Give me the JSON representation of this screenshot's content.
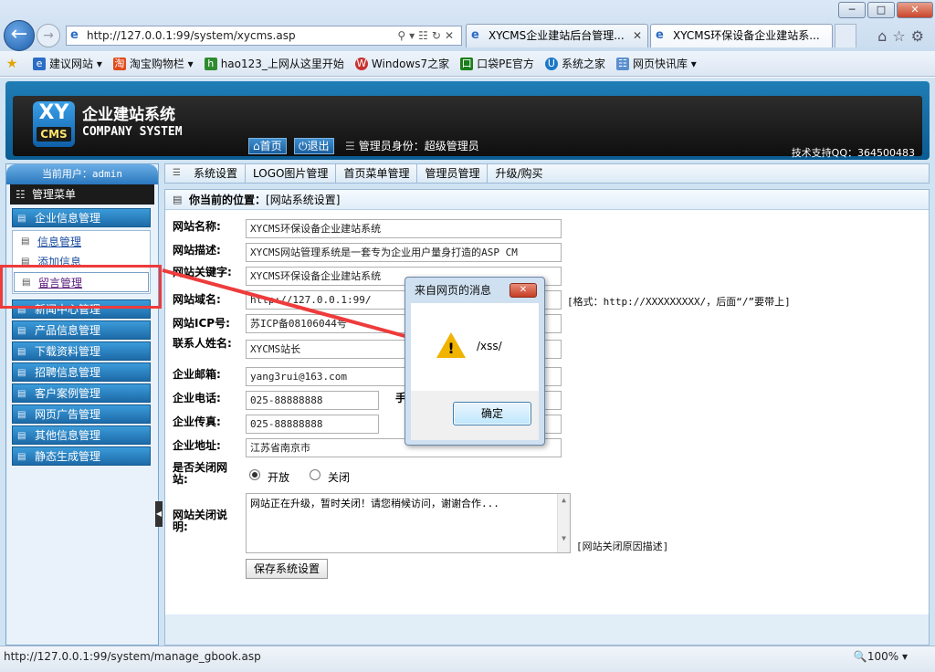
{
  "browser": {
    "address": "http://127.0.0.1:99/system/xycms.asp",
    "tabs": [
      {
        "label": "XYCMS企业建站后台管理..."
      },
      {
        "label": "XYCMS环保设备企业建站系..."
      }
    ],
    "window_buttons": {
      "minimize": "─",
      "maximize": "□",
      "close": "✕"
    },
    "favorites": [
      {
        "label": "建议网站 ▾",
        "icon": "ie-icon"
      },
      {
        "label": "淘宝购物栏 ▾",
        "icon": "taobao-icon"
      },
      {
        "label": "hao123_上网从这里开始",
        "icon": "hao123-icon"
      },
      {
        "label": "Windows7之家",
        "icon": "windows7-icon"
      },
      {
        "label": "口袋PE官方",
        "icon": "pe-icon"
      },
      {
        "label": "系统之家",
        "icon": "xitong-icon"
      },
      {
        "label": "网页快讯库 ▾",
        "icon": "webslice-icon"
      }
    ],
    "status_url": "http://127.0.0.1:99/system/manage_gbook.asp",
    "zoom": "🔍100% ▾"
  },
  "header": {
    "logo_top": "XY",
    "logo_bottom": "CMS",
    "brand_cn": "企业建站系统",
    "brand_en": "COMPANY SYSTEM",
    "home_label": "首页",
    "exit_label": "退出",
    "role_text": "管理员身份：超级管理员",
    "support_text": "技术支持QQ：364500483"
  },
  "sidebar": {
    "current_user": "当前用户：admin",
    "menu_title": "管理菜单",
    "categories": [
      "企业信息管理",
      "新闻中心管理",
      "产品信息管理",
      "下载资料管理",
      "招聘信息管理",
      "客户案例管理",
      "网页广告管理",
      "其他信息管理",
      "静态生成管理"
    ],
    "sub_items": [
      "信息管理",
      "添加信息",
      "留言管理"
    ]
  },
  "toolbar": {
    "items": [
      "系统设置",
      "LOGO图片管理",
      "首页菜单管理",
      "管理员管理",
      "升级/购买"
    ]
  },
  "location": {
    "label": "你当前的位置：",
    "value": "[网站系统设置]"
  },
  "form": {
    "site_name_label": "网站名称:",
    "site_name": "XYCMS环保设备企业建站系统",
    "site_desc_label": "网站描述:",
    "site_desc": "XYCMS网站管理系统是一套专为企业用户量身打造的ASP CM",
    "keywords_label": "网站关键字:",
    "keywords": "XYCMS环保设备企业建站系统",
    "domain_label": "网站域名:",
    "domain": "http://127.0.0.1:99/",
    "domain_hint": "[格式：http://XXXXXXXXX/，后面“/”要带上]",
    "icp_label": "网站ICP号:",
    "icp": "苏ICP备08106044号",
    "contact_label": "联系人姓名:",
    "contact": "XYCMS站长",
    "email_label": "企业邮箱:",
    "email": "yang3rui@163.com",
    "phone_label": "企业电话:",
    "phone": "025-88888888",
    "mobile_label": "手",
    "fax_label": "企业传真:",
    "fax": "025-88888888",
    "address_label": "企业地址:",
    "address": "江苏省南京市",
    "close_label": "是否关闭网站:",
    "open_option": "开放",
    "close_option": "关闭",
    "close_reason_label": "网站关闭说明:",
    "close_reason": "网站正在升级，暂时关闭！请您稍候访问，谢谢合作...",
    "close_reason_hint": "[网站关闭原因描述]",
    "save_label": "保存系统设置"
  },
  "dialog": {
    "title": "来自网页的消息",
    "close": "✕",
    "message": "/xss/",
    "ok_label": "确定"
  },
  "colors": {
    "highlight_box": "#ee3b3b",
    "arrow": "#ee3b3b"
  }
}
